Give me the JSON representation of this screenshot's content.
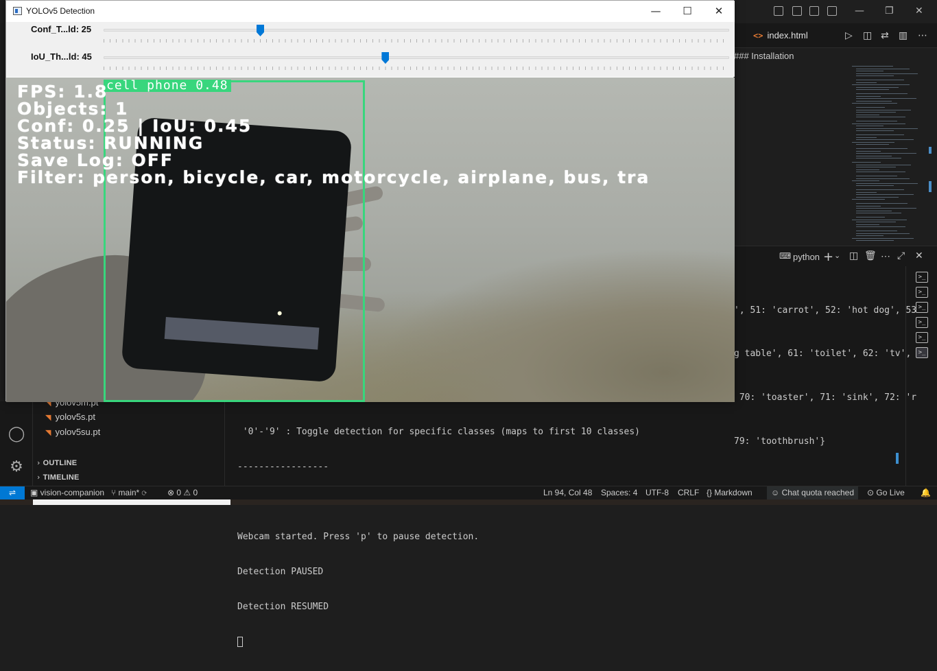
{
  "cv_window": {
    "title": "YOLOv5 Detection",
    "trackbars": [
      {
        "label": "Conf_T...ld: 25",
        "value": 25,
        "max": 100
      },
      {
        "label": "IoU_Th...ld: 45",
        "value": 45,
        "max": 100
      }
    ],
    "detection": {
      "label": "cell phone 0.48"
    },
    "overlay": {
      "fps": "FPS: 1.8",
      "objects": "Objects: 1",
      "conf_iou": "Conf: 0.25 | IoU: 0.45",
      "status": "Status: RUNNING",
      "save_log": "Save Log: OFF",
      "filter": "Filter: person, bicycle, car, motorcycle, airplane, bus, tra"
    }
  },
  "vscode": {
    "tab": {
      "tag": "<>",
      "name": "index.html"
    },
    "breadcrumb": "### Installation",
    "terminal_name": "python",
    "terminal_right_lines": [
      "', 51: 'carrot', 52: 'hot dog', 53",
      "g table', 61: 'toilet', 62: 'tv',",
      " 70: 'toaster', 71: 'sink', 72: 'r",
      "79: 'toothbrush'}"
    ],
    "terminal_lines": [
      " '0'-'9' : Toggle detection for specific classes (maps to first 10 classes)",
      "-----------------",
      "",
      "Webcam started. Press 'p' to pause detection.",
      "Detection PAUSED",
      "Detection RESUMED"
    ],
    "explorer_files": [
      "yolov5m.pt",
      "yolov5s.pt",
      "yolov5su.pt"
    ],
    "sections": [
      "OUTLINE",
      "TIMELINE"
    ],
    "status": {
      "branch_repo": "vision-companion",
      "branch": "main*",
      "problems": "⊗ 0 ⚠ 0",
      "position": "Ln 94, Col 48",
      "spaces": "Spaces: 4",
      "encoding": "UTF-8",
      "eol": "CRLF",
      "language": "Markdown",
      "chat": "Chat quota reached",
      "golive": "Go Live"
    }
  },
  "colors": {
    "bbox": "#38d67d",
    "thumb": "#0078d7",
    "vscode_accent": "#0078d4"
  }
}
